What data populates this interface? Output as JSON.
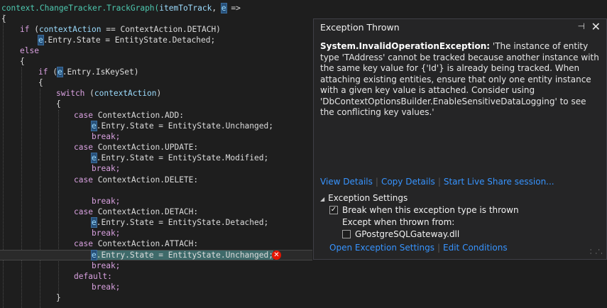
{
  "code": {
    "l1_a": "context.ChangeTracker.TrackGraph(",
    "l1_b": "itemToTrack",
    "l1_c": ", ",
    "l1_d": "e",
    "l1_e": " =>",
    "l2": "{",
    "l3_a": "if",
    "l3_b": " (",
    "l3_c": "contextAction",
    "l3_d": " == ContextAction.DETACH)",
    "l4_a": "e",
    "l4_b": ".Entry.State = EntityState.Detached;",
    "l5": "else",
    "l6": "{",
    "l7_a": "if",
    "l7_b": " (",
    "l7_c": "e",
    "l7_d": ".Entry.IsKeySet)",
    "l8": "{",
    "l9_a": "switch",
    "l9_b": " (",
    "l9_c": "contextAction",
    "l9_d": ")",
    "l10": "{",
    "l11_a": "case",
    "l11_b": " ContextAction.ADD:",
    "l12_a": "e",
    "l12_b": ".Entry.State = EntityState.Unchanged;",
    "l13": "break;",
    "l14_a": "case",
    "l14_b": " ContextAction.UPDATE:",
    "l15_a": "e",
    "l15_b": ".Entry.State = EntityState.Modified;",
    "l16": "break;",
    "l17_a": "case",
    "l17_b": " ContextAction.DELETE:",
    "l19": "break;",
    "l20_a": "case",
    "l20_b": " ContextAction.DETACH:",
    "l21_a": "e",
    "l21_b": ".Entry.State = EntityState.Detached;",
    "l22": "break;",
    "l23_a": "case",
    "l23_b": " ContextAction.ATTACH:",
    "l24_a": "e",
    "l24_b": ".Entry.State = EntityState.Unchanged;",
    "l25": "break;",
    "l26": "default:",
    "l27": "break;",
    "l28": "}"
  },
  "popup": {
    "title": "Exception Thrown",
    "pin_glyph": "⊣",
    "close_glyph": "✕",
    "exception_type": "System.InvalidOperationException:",
    "message": " 'The instance of entity type 'TAddress' cannot be tracked because another instance with the same key value for {'Id'} is already being tracked. When attaching existing entities, ensure that only one entity instance with a given key value is attached. Consider using 'DbContextOptionsBuilder.EnableSensitiveDataLogging' to see the conflicting key values.'",
    "link_view_details": "View Details",
    "link_copy_details": "Copy Details",
    "link_live_share": "Start Live Share session...",
    "settings_header": "Exception Settings",
    "break_when_label": "Break when this exception type is thrown",
    "break_when_checked": true,
    "except_when_label": "Except when thrown from:",
    "module_label": "GPostgreSQLGateway.dll",
    "module_checked": false,
    "link_open_settings": "Open Exception Settings",
    "link_edit_conditions": "Edit Conditions"
  },
  "icons": {
    "error": "error-icon",
    "pin": "pin-icon",
    "close": "close-icon",
    "collapse": "collapse-triangle-icon",
    "resize": "resize-grip-icon"
  },
  "colors": {
    "editor_bg": "#1e1e1e",
    "keyword": "#569cd6",
    "control_keyword": "#d8a0df",
    "identifier": "#9cdcfe",
    "link": "#3794ff",
    "error": "#e51400"
  }
}
